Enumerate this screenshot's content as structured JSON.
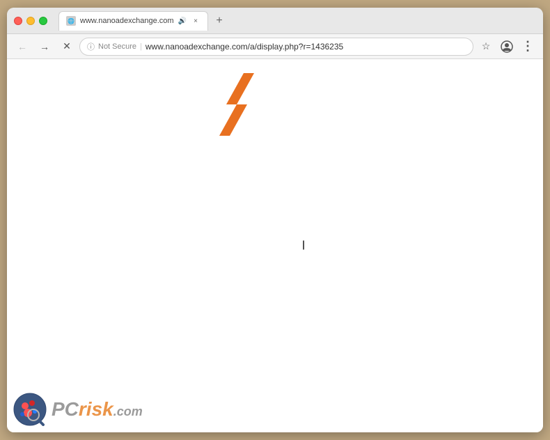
{
  "browser": {
    "tab": {
      "title": "www.nanoadexchange.com",
      "has_audio": true,
      "close_label": "×",
      "new_tab_label": "+"
    },
    "nav": {
      "back_label": "←",
      "forward_label": "→",
      "close_label": "×",
      "not_secure": "Not Secure",
      "url": "www.nanoadexchange.com/a/display.php?r=1436235",
      "bookmark_label": "☆",
      "profile_label": "⊙",
      "menu_label": "⋮"
    }
  },
  "page": {
    "cursor_char": "I",
    "background": "#ffffff"
  },
  "watermark": {
    "pc_label": "PC",
    "risk_label": "risk",
    "dotcom_label": ".com"
  }
}
